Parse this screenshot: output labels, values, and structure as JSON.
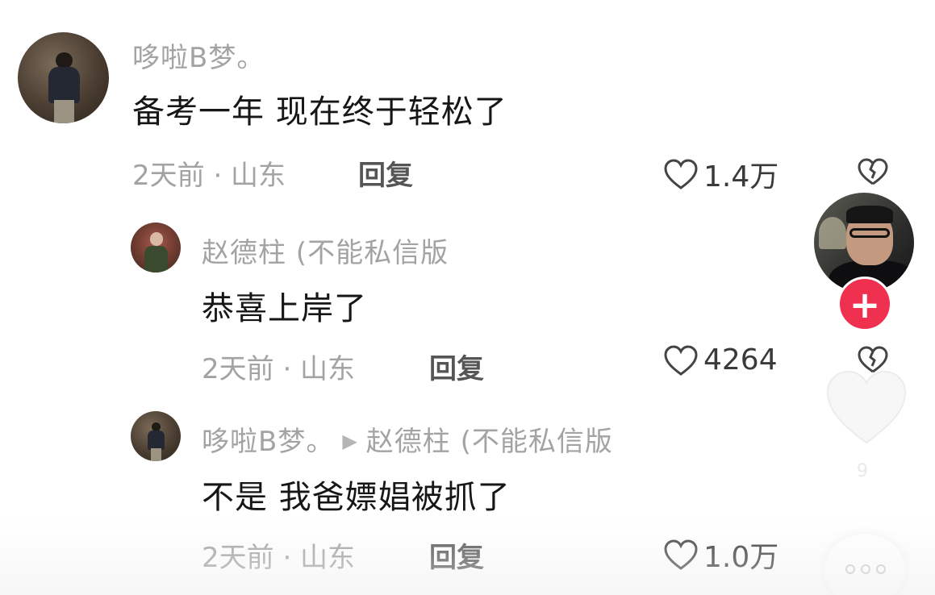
{
  "comments": [
    {
      "username": "哆啦B梦。",
      "text": "备考一年 现在终于轻松了",
      "meta": "2天前 · 山东",
      "reply_label": "回复",
      "likes": "1.4万"
    },
    {
      "username": "赵德柱 (不能私信版",
      "text": "恭喜上岸了",
      "meta": "2天前 · 山东",
      "reply_label": "回复",
      "likes": "4264"
    },
    {
      "username": "哆啦B梦。",
      "reply_to": "赵德柱 (不能私信版",
      "text": "不是 我爸嫖娼被抓了",
      "meta": "2天前 · 山东",
      "reply_label": "回复",
      "likes": "1.0万"
    }
  ],
  "sidebar": {
    "follow_symbol": "+",
    "like_count": "9"
  },
  "colors": {
    "follow_accent": "#f0304f",
    "username_gray": "#a3a3a3",
    "text_dark": "#161616"
  },
  "icons": [
    "heart-outline-icon",
    "heart-broken-icon",
    "play-arrow-icon",
    "plus-icon",
    "more-dots-icon"
  ]
}
